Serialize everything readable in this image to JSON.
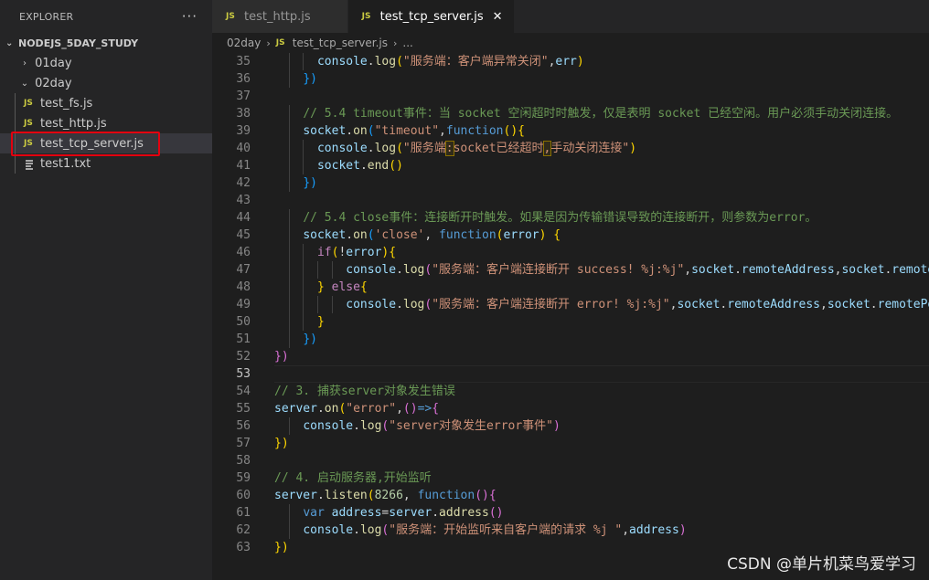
{
  "sidebar": {
    "title": "EXPLORER",
    "more_label": "···",
    "project": "NODEJS_5DAY_STUDY",
    "items": [
      {
        "label": "01day",
        "kind": "folder",
        "expanded": false
      },
      {
        "label": "02day",
        "kind": "folder",
        "expanded": true
      },
      {
        "label": "test_fs.js",
        "kind": "js"
      },
      {
        "label": "test_http.js",
        "kind": "js"
      },
      {
        "label": "test_tcp_server.js",
        "kind": "js",
        "selected": true
      },
      {
        "label": "test1.txt",
        "kind": "txt"
      }
    ],
    "js_icon": "JS"
  },
  "tabs": [
    {
      "label": "test_http.js",
      "active": false
    },
    {
      "label": "test_tcp_server.js",
      "active": true,
      "close": "✕"
    }
  ],
  "breadcrumb": {
    "folder": "02day",
    "file": "test_tcp_server.js",
    "more": "..."
  },
  "editor": {
    "current_line": 53,
    "lines": [
      {
        "n": 35,
        "text": "      console.log(\"服务端：客户端异常关闭\",err)"
      },
      {
        "n": 36,
        "text": "    })"
      },
      {
        "n": 37,
        "text": ""
      },
      {
        "n": 38,
        "text": "    // 5.4 timeout事件：当 socket 空闲超时时触发，仅是表明 socket 已经空闲。用户必须手动关闭连接。"
      },
      {
        "n": 39,
        "text": "    socket.on(\"timeout\",function(){"
      },
      {
        "n": 40,
        "text": "      console.log(\"服务端: socket已经超时, 手动关闭连接\")"
      },
      {
        "n": 41,
        "text": "      socket.end()"
      },
      {
        "n": 42,
        "text": "    })"
      },
      {
        "n": 43,
        "text": ""
      },
      {
        "n": 44,
        "text": "    // 5.4 close事件：连接断开时触发。如果是因为传输错误导致的连接断开，则参数为error。"
      },
      {
        "n": 45,
        "text": "    socket.on('close', function(error) {"
      },
      {
        "n": 46,
        "text": "      if(!error){"
      },
      {
        "n": 47,
        "text": "          console.log(\"服务端：客户端连接断开 success! %j:%j\",socket.remoteAddress,socket.remoteP"
      },
      {
        "n": 48,
        "text": "      } else{"
      },
      {
        "n": 49,
        "text": "          console.log(\"服务端：客户端连接断开 error! %j:%j\",socket.remoteAddress,socket.remotePor"
      },
      {
        "n": 50,
        "text": "      }"
      },
      {
        "n": 51,
        "text": "    })"
      },
      {
        "n": 52,
        "text": "})"
      },
      {
        "n": 53,
        "text": ""
      },
      {
        "n": 54,
        "text": "// 3. 捕获server对象发生错误"
      },
      {
        "n": 55,
        "text": "server.on(\"error\",()=>{"
      },
      {
        "n": 56,
        "text": "    console.log(\"server对象发生error事件\")"
      },
      {
        "n": 57,
        "text": "})"
      },
      {
        "n": 58,
        "text": ""
      },
      {
        "n": 59,
        "text": "// 4. 启动服务器,开始监听"
      },
      {
        "n": 60,
        "text": "server.listen(8266, function(){"
      },
      {
        "n": 61,
        "text": "    var address=server.address()"
      },
      {
        "n": 62,
        "text": "    console.log(\"服务端：开始监听来自客户端的请求 %j \",address)"
      },
      {
        "n": 63,
        "text": "})"
      }
    ]
  },
  "watermark": "CSDN @单片机菜鸟爱学习",
  "colors": {
    "highlight_box": "#e3000f",
    "js_icon": "#cbcb41"
  }
}
